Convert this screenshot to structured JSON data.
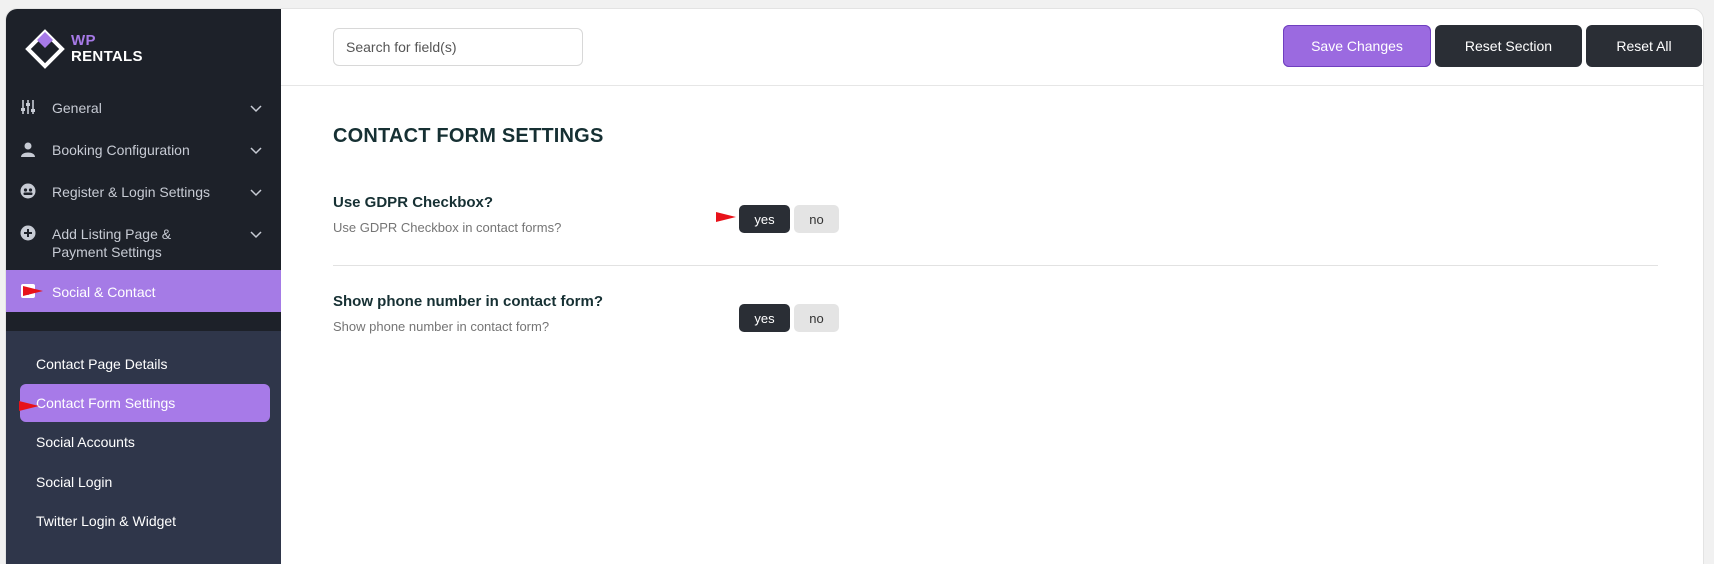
{
  "brand": {
    "line1": "WP",
    "line2": "RENTALS"
  },
  "sidebar": {
    "items": [
      {
        "label": "General",
        "icon": "sliders-icon"
      },
      {
        "label": "Booking Configuration",
        "icon": "user-icon"
      },
      {
        "label": "Register & Login Settings",
        "icon": "users-circle-icon"
      },
      {
        "label": "Add Listing Page & Payment Settings",
        "icon": "plus-circle-icon"
      },
      {
        "label": "Social & Contact",
        "icon": "contact-card-icon"
      }
    ],
    "sub_items": [
      {
        "label": "Contact Page Details"
      },
      {
        "label": "Contact Form Settings"
      },
      {
        "label": "Social Accounts"
      },
      {
        "label": "Social Login"
      },
      {
        "label": "Twitter Login & Widget"
      }
    ]
  },
  "topbar": {
    "search_placeholder": "Search for field(s)",
    "save_label": "Save Changes",
    "reset_section_label": "Reset Section",
    "reset_all_label": "Reset All"
  },
  "main": {
    "section_title": "CONTACT FORM SETTINGS",
    "fields": [
      {
        "title": "Use GDPR Checkbox?",
        "description": "Use GDPR Checkbox in contact forms?",
        "yes": "yes",
        "no": "no",
        "selected": "yes"
      },
      {
        "title": "Show phone number in contact form?",
        "description": "Show phone number in contact form?",
        "yes": "yes",
        "no": "no",
        "selected": "yes"
      }
    ]
  },
  "colors": {
    "accent": "#a77ae8",
    "sidebar_bg": "#1d2129",
    "submenu_bg": "#2f364a",
    "dark_button": "#2a2e35",
    "annotation_arrow": "#e8121a"
  }
}
